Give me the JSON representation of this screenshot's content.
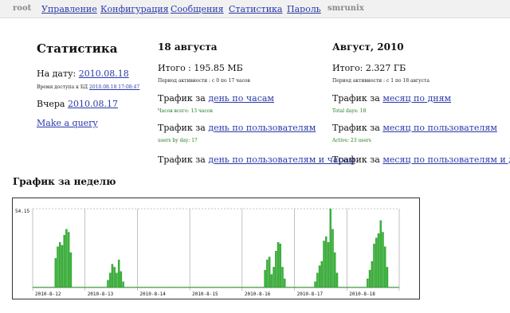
{
  "nav": {
    "user": "root",
    "items": [
      "Управление",
      "Конфигурация",
      "Сообщения",
      "Статистика",
      "Пароль"
    ],
    "app": "smrunix"
  },
  "stats": {
    "title": "Статистика",
    "date_label": "На дату:",
    "date_value": "2010.08.18",
    "db_access_label": "Время доступа к БД",
    "db_access_value": "2010.08.18 17:08:47",
    "yesterday_label": "Вчера",
    "yesterday_value": "2010.08.17",
    "query_link": "Make a query"
  },
  "day": {
    "title": "18 августа",
    "total": "Итого : 195.85 МБ",
    "activity": "Период активности : с 0 по 17 часов",
    "traffic_prefix": "Трафик за",
    "link_hours": "день по часам",
    "hours_total": "Часов всего: 13 часов",
    "link_users": "день по пользователям",
    "users_by_day": "users by day: 17",
    "link_users_hours": "день по пользователям и часам"
  },
  "month": {
    "title": "Август, 2010",
    "total": "Итого: 2.327 ГБ",
    "activity": "Период активности : с 1 по 18 августа",
    "traffic_prefix": "Трафик за",
    "link_days": "месяц по дням",
    "total_days": "Total days: 18",
    "link_users": "месяц по пользователям",
    "active_users": "Active: 23 users",
    "link_users_days": "месяц по пользователям и дням"
  },
  "week_title": "График за неделю",
  "chart_data": {
    "type": "bar",
    "title": "",
    "y_max_label": "54.15",
    "ylim": [
      0,
      54.15
    ],
    "bar_color": "#38b838",
    "categories": [
      "2010-8-12",
      "2010-8-13",
      "2010-8-14",
      "2010-8-15",
      "2010-8-16",
      "2010-8-17",
      "2010-8-18"
    ],
    "series": [
      {
        "values": [
          0,
          0,
          0,
          0,
          0,
          0,
          0,
          0,
          0,
          0,
          20,
          28,
          31,
          29,
          36,
          40,
          38,
          24,
          0,
          0,
          0,
          0,
          0,
          0
        ]
      },
      {
        "values": [
          0,
          0,
          0,
          0,
          0,
          0,
          0,
          0,
          0,
          0,
          5,
          10,
          16,
          14,
          10,
          19,
          11,
          4,
          0,
          0,
          0,
          0,
          0,
          0
        ]
      },
      {
        "values": [
          0,
          0,
          0,
          0,
          0,
          0,
          0,
          0,
          0,
          0,
          0,
          0,
          0,
          0,
          0,
          0,
          0,
          0,
          0,
          0,
          0,
          0,
          0,
          0
        ]
      },
      {
        "values": [
          0,
          0,
          0,
          0,
          0,
          0,
          0,
          0,
          0,
          0,
          0,
          0,
          0,
          0,
          0,
          0,
          0,
          0,
          0,
          0,
          0,
          0,
          0,
          0
        ]
      },
      {
        "values": [
          0,
          0,
          0,
          0,
          0,
          0,
          0,
          0,
          0,
          0,
          12,
          19,
          21,
          9,
          14,
          25,
          31,
          30,
          14,
          6,
          0,
          0,
          0,
          0
        ]
      },
      {
        "values": [
          0,
          0,
          0,
          0,
          0,
          0,
          0,
          0,
          0,
          4,
          10,
          15,
          18,
          32,
          35,
          31,
          54,
          40,
          24,
          10,
          0,
          0,
          0,
          0
        ]
      },
      {
        "values": [
          0,
          0,
          0,
          0,
          0,
          0,
          0,
          0,
          0,
          6,
          12,
          18,
          30,
          34,
          37,
          46,
          38,
          28,
          14,
          0,
          0,
          0,
          0,
          0
        ]
      }
    ]
  }
}
